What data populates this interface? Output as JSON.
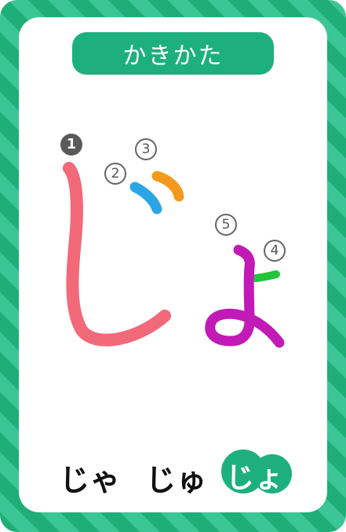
{
  "header": {
    "title": "かきかた"
  },
  "stroke_order": {
    "numbers": [
      "1",
      "2",
      "3",
      "4",
      "5"
    ],
    "colors": {
      "stroke1": "#f2697a",
      "stroke2": "#2aa6e6",
      "stroke3": "#f39a1e",
      "stroke4": "#22c43a",
      "stroke5": "#c21ab6"
    }
  },
  "kana_row": {
    "items": [
      "じゃ",
      "じゅ",
      "じょ"
    ],
    "active_index": 2
  },
  "colors": {
    "border_dark": "#1fae78",
    "border_light": "#3cc596",
    "accent": "#1db07e"
  }
}
